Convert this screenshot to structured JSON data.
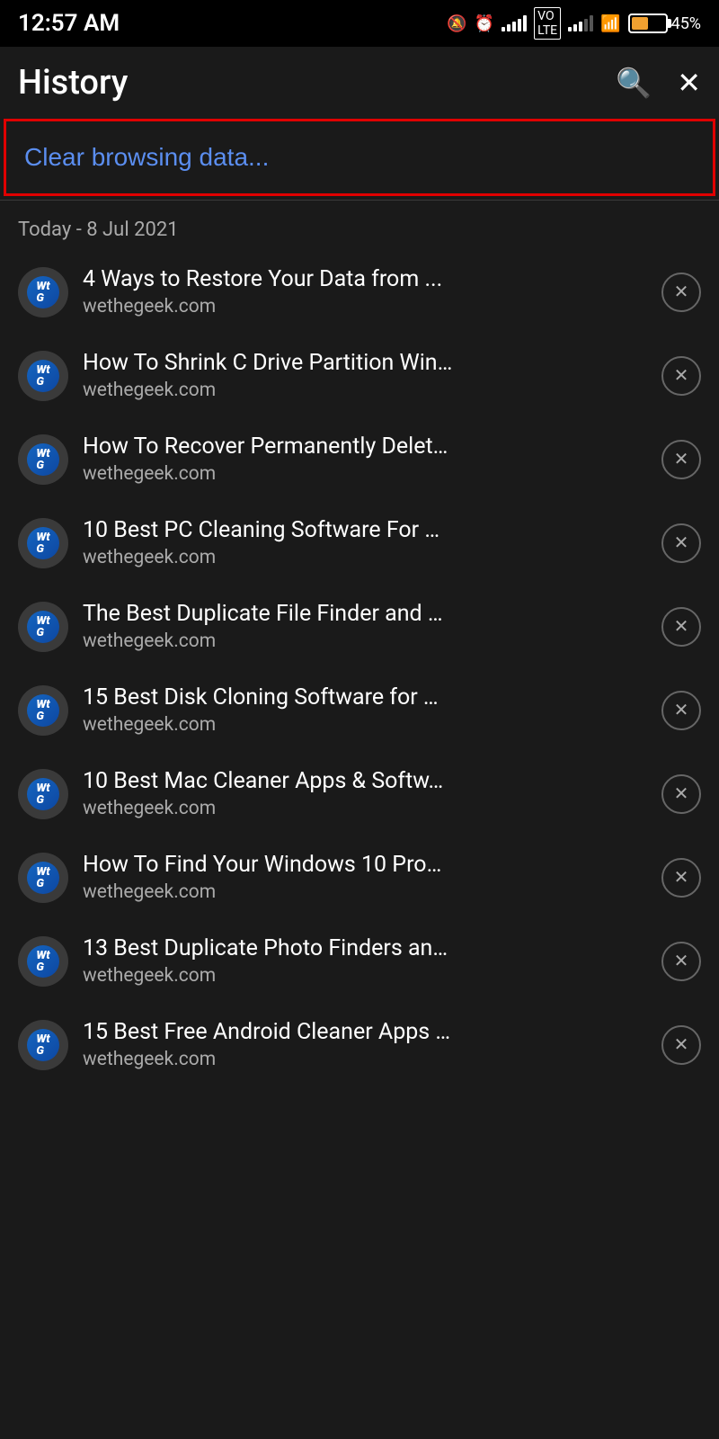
{
  "statusBar": {
    "time": "12:57 AM",
    "battery": "45%"
  },
  "header": {
    "title": "History",
    "searchIcon": "🔍",
    "closeIcon": "✕"
  },
  "clearBrowsing": {
    "label": "Clear browsing data..."
  },
  "dateSection": {
    "label": "Today - 8 Jul 2021"
  },
  "historyItems": [
    {
      "title": "4 Ways to Restore Your Data from ...",
      "url": "wethegeek.com"
    },
    {
      "title": "How To Shrink C Drive Partition Win…",
      "url": "wethegeek.com"
    },
    {
      "title": "How To Recover Permanently Delet…",
      "url": "wethegeek.com"
    },
    {
      "title": "10 Best PC Cleaning Software For …",
      "url": "wethegeek.com"
    },
    {
      "title": "The Best Duplicate File Finder and …",
      "url": "wethegeek.com"
    },
    {
      "title": "15 Best Disk Cloning Software for …",
      "url": "wethegeek.com"
    },
    {
      "title": "10 Best Mac Cleaner Apps & Softw…",
      "url": "wethegeek.com"
    },
    {
      "title": "How To Find Your Windows 10 Pro…",
      "url": "wethegeek.com"
    },
    {
      "title": "13 Best Duplicate Photo Finders an…",
      "url": "wethegeek.com"
    },
    {
      "title": "15 Best Free Android Cleaner Apps …",
      "url": "wethegeek.com"
    }
  ]
}
